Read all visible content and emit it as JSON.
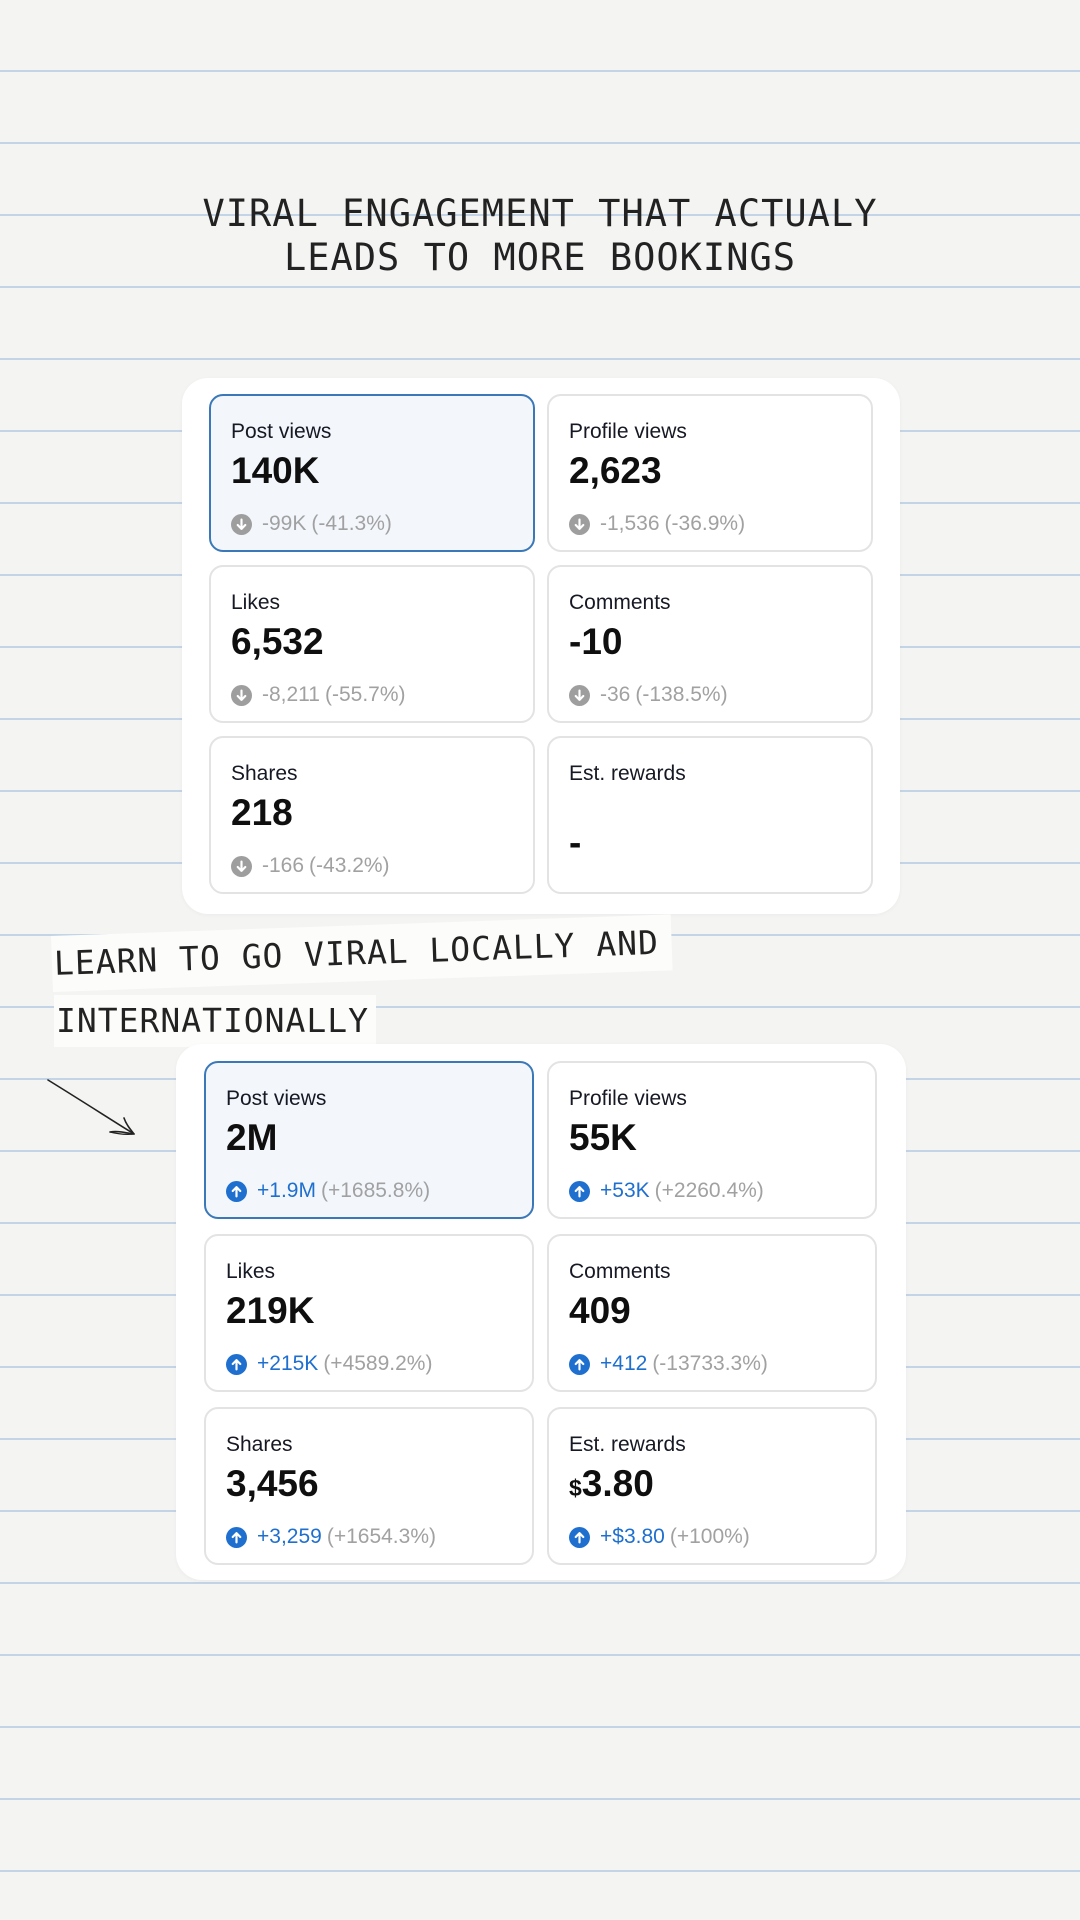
{
  "headline": {
    "line1": "VIRAL ENGAGEMENT THAT ACTUALY",
    "line2": "LEADS TO MORE BOOKINGS"
  },
  "note": {
    "line1": "LEARN TO GO VIRAL LOCALLY AND",
    "line2": "INTERNATIONALLY"
  },
  "colors": {
    "selected_border": "#3b78b8",
    "positive": "#1f6fcf",
    "negative": "#9e9e9e",
    "ruled_line": "#c2d4e6"
  },
  "before_stats": [
    {
      "label": "Post views",
      "value": "140K",
      "delta": "-99K",
      "pct": "(-41.3%)",
      "direction": "down",
      "icon": "arrow-down-circle-icon"
    },
    {
      "label": "Profile views",
      "value": "2,623",
      "delta": "-1,536",
      "pct": "(-36.9%)",
      "direction": "down",
      "icon": "arrow-down-circle-icon"
    },
    {
      "label": "Likes",
      "value": "6,532",
      "delta": "-8,211",
      "pct": "(-55.7%)",
      "direction": "down",
      "icon": "arrow-down-circle-icon"
    },
    {
      "label": "Comments",
      "value": "-10",
      "delta": "-36",
      "pct": "(-138.5%)",
      "direction": "down",
      "icon": "arrow-down-circle-icon"
    },
    {
      "label": "Shares",
      "value": "218",
      "delta": "-166",
      "pct": "(-43.2%)",
      "direction": "down",
      "icon": "arrow-down-circle-icon"
    },
    {
      "label": "Est. rewards",
      "value": "-"
    }
  ],
  "after_stats": [
    {
      "label": "Post views",
      "value": "2M",
      "delta": "+1.9M",
      "pct": "(+1685.8%)",
      "direction": "up",
      "icon": "arrow-up-circle-icon"
    },
    {
      "label": "Profile views",
      "value": "55K",
      "delta": "+53K",
      "pct": "(+2260.4%)",
      "direction": "up",
      "icon": "arrow-up-circle-icon"
    },
    {
      "label": "Likes",
      "value": "219K",
      "delta": "+215K",
      "pct": "(+4589.2%)",
      "direction": "up",
      "icon": "arrow-up-circle-icon"
    },
    {
      "label": "Comments",
      "value": "409",
      "delta": "+412",
      "pct": "(-13733.3%)",
      "direction": "up",
      "icon": "arrow-up-circle-icon"
    },
    {
      "label": "Shares",
      "value": "3,456",
      "delta": "+3,259",
      "pct": "(+1654.3%)",
      "direction": "up",
      "icon": "arrow-up-circle-icon"
    },
    {
      "label": "Est. rewards",
      "currency": "$",
      "value": "3.80",
      "delta": "+$3.80",
      "pct": "(+100%)",
      "direction": "up",
      "icon": "arrow-up-circle-icon"
    }
  ]
}
